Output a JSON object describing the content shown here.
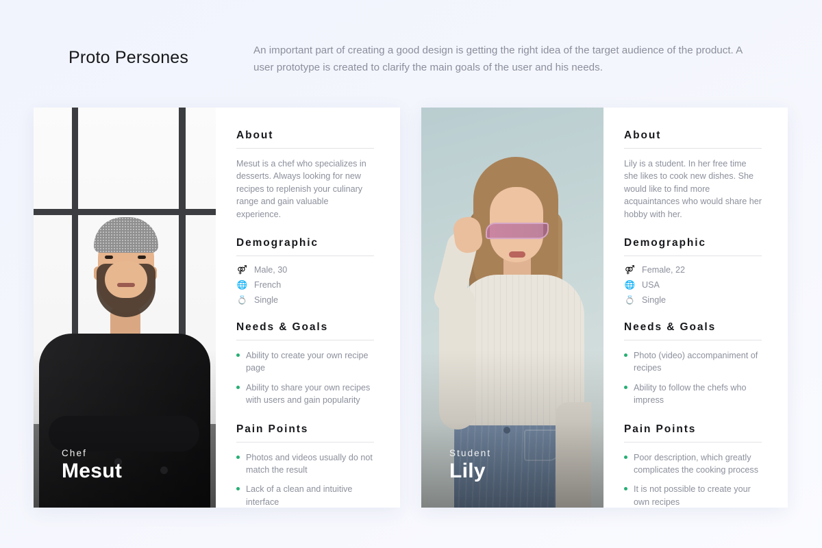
{
  "header": {
    "title": "Proto Persones",
    "description": "An important part of creating a good design is getting the right idea of the target audience of the product. A user prototype is created to clarify the main goals of the user and his needs."
  },
  "sections": {
    "about": "About",
    "demographic": "Demographic",
    "needs": "Needs & Goals",
    "pain": "Pain Points"
  },
  "colors": {
    "background": "#f2f4fd",
    "card": "#ffffff",
    "heading": "#17181c",
    "body_text": "#8c909c",
    "bullet": "#27ae74",
    "rule": "#e3e3e6"
  },
  "personas": [
    {
      "role": "Chef",
      "name": "Mesut",
      "about": "Mesut is a chef who specializes in desserts. Always looking for new recipes to replenish your culinary range and gain valuable experience.",
      "demographic": [
        {
          "icon": "gender-icon",
          "glyph": "⚤",
          "label": "Male, 30"
        },
        {
          "icon": "globe-icon",
          "glyph": "🌐",
          "label": "French"
        },
        {
          "icon": "rings-icon",
          "glyph": "💍",
          "label": "Single"
        }
      ],
      "needs": [
        "Ability to create your own recipe page",
        "Ability to share your own recipes with users and gain popularity"
      ],
      "pain": [
        "Photos and videos usually do not match the result",
        "Lack of a clean and intuitive interface"
      ]
    },
    {
      "role": "Student",
      "name": "Lily",
      "about": "Lily is a student. In her free time she likes to cook new dishes. She would like to find more acquaintances who would share her hobby with her.",
      "demographic": [
        {
          "icon": "gender-icon",
          "glyph": "⚤",
          "label": "Female, 22"
        },
        {
          "icon": "globe-icon",
          "glyph": "🌐",
          "label": "USA"
        },
        {
          "icon": "rings-icon",
          "glyph": "💍",
          "label": "Single"
        }
      ],
      "needs": [
        "Photo (video) accompaniment of recipes",
        "Ability to follow the chefs who impress"
      ],
      "pain": [
        "Poor description, which greatly complicates the cooking process",
        "It is not possible to create your own recipes"
      ]
    }
  ]
}
